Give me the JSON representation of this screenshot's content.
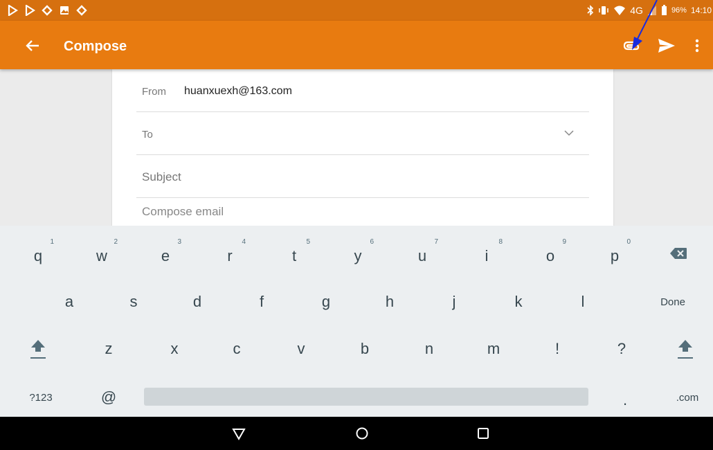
{
  "status_bar": {
    "network_label": "4G",
    "battery_percent": "96%",
    "time": "14:10",
    "notification_icons": [
      "play-store-icon",
      "play-store-icon",
      "sync-icon",
      "image-icon",
      "sync-icon"
    ],
    "system_icons": [
      "bluetooth-icon",
      "vibrate-icon",
      "wifi-icon",
      "signal-icon",
      "battery-icon"
    ]
  },
  "app_bar": {
    "title": "Compose",
    "background_color": "#e87b10",
    "actions": [
      "attach-icon",
      "send-icon",
      "more-vert-icon"
    ]
  },
  "compose": {
    "from_label": "From",
    "from_value": "huanxuexh@163.com",
    "to_label": "To",
    "subject_placeholder": "Subject",
    "body_placeholder": "Compose email"
  },
  "keyboard": {
    "row1": [
      {
        "key": "q",
        "hint": "1"
      },
      {
        "key": "w",
        "hint": "2"
      },
      {
        "key": "e",
        "hint": "3"
      },
      {
        "key": "r",
        "hint": "4"
      },
      {
        "key": "t",
        "hint": "5"
      },
      {
        "key": "y",
        "hint": "6"
      },
      {
        "key": "u",
        "hint": "7"
      },
      {
        "key": "i",
        "hint": "8"
      },
      {
        "key": "o",
        "hint": "9"
      },
      {
        "key": "p",
        "hint": "0"
      }
    ],
    "row2": [
      "a",
      "s",
      "d",
      "f",
      "g",
      "h",
      "j",
      "k",
      "l"
    ],
    "row2_action": "Done",
    "row3": [
      "z",
      "x",
      "c",
      "v",
      "b",
      "n",
      "m",
      "!",
      "?"
    ],
    "row4_symbols": "?123",
    "row4_at": "@",
    "row4_period": ".",
    "row4_com": ".com"
  }
}
